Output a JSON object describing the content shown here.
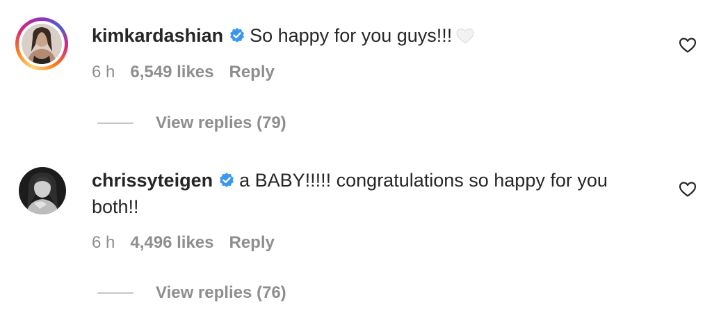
{
  "comments": [
    {
      "username": "kimkardashian",
      "text": "So happy for you guys!!!",
      "emoji": "white-heart-icon",
      "time": "6 h",
      "likes": "6,549 likes",
      "reply_label": "Reply",
      "view_replies": "View replies (79)",
      "story_ring": true
    },
    {
      "username": "chrissyteigen",
      "text": "a BABY!!!!! congratulations so happy for you both!!",
      "time": "6 h",
      "likes": "4,496 likes",
      "reply_label": "Reply",
      "view_replies": "View replies (76)",
      "story_ring": false
    }
  ],
  "colors": {
    "verified_badge": "#3897f0",
    "muted_text": "#8e8e8e",
    "primary_text": "#262626"
  }
}
